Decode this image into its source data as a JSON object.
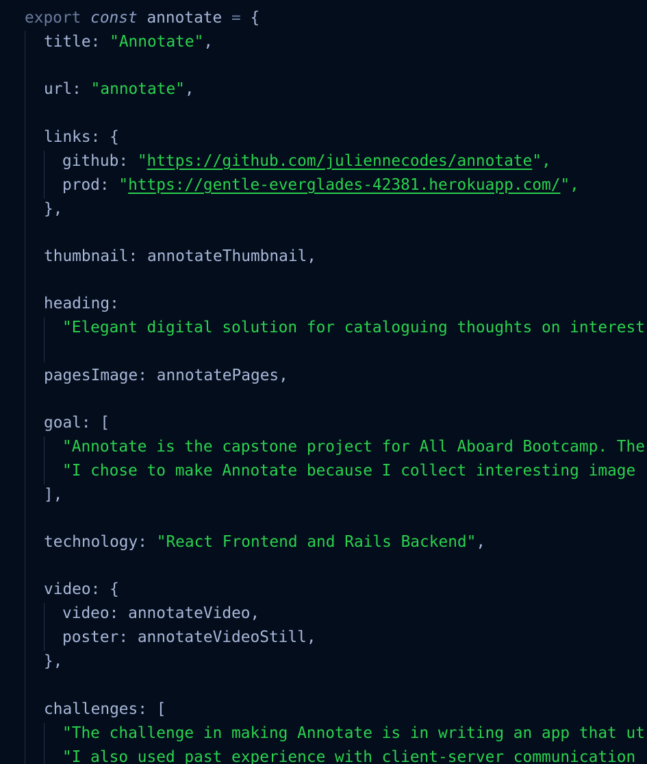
{
  "editor": {
    "colors": {
      "background": "#040d1c",
      "keyword": "#6a7c9e",
      "identifier": "#a8b7d8",
      "string": "#2bd24e",
      "indent_guide": "#243049"
    },
    "line1": {
      "kw": "export",
      "storage": "const",
      "name": "annotate",
      "op": "=",
      "brace": "{"
    },
    "title": {
      "key": "title:",
      "value": "\"Annotate\"",
      "end": ","
    },
    "url": {
      "key": "url:",
      "value": "\"annotate\"",
      "end": ","
    },
    "links": {
      "key": "links: {",
      "github_key": "github:",
      "github_q1": "\"",
      "github_url": "https://github.com/juliennecodes/annotate",
      "github_q2": "\",",
      "prod_key": "prod:",
      "prod_q1": "\"",
      "prod_url": "https://gentle-everglades-42381.herokuapp.com/",
      "prod_q2": "\",",
      "close": "},"
    },
    "thumbnail": {
      "key": "thumbnail:",
      "value": "annotateThumbnail,"
    },
    "heading": {
      "key": "heading:",
      "value": "\"Elegant digital solution for cataloguing thoughts on interest"
    },
    "pagesImage": {
      "key": "pagesImage:",
      "value": "annotatePages,"
    },
    "goal": {
      "key": "goal: [",
      "line1": "\"Annotate is the capstone project for All Aboard Bootcamp. The",
      "line2": "\"I chose to make Annotate because I collect interesting image",
      "close": "],"
    },
    "technology": {
      "key": "technology:",
      "value": "\"React Frontend and Rails Backend\"",
      "end": ","
    },
    "video": {
      "key": "video: {",
      "video_key": "video:",
      "video_value": "annotateVideo,",
      "poster_key": "poster:",
      "poster_value": "annotateVideoStill,",
      "close": "},"
    },
    "challenges": {
      "key": "challenges: [",
      "line1": "\"The challenge in making Annotate is in writing an app that ut",
      "line2": "\"I also used past experience with client-server communication"
    }
  }
}
